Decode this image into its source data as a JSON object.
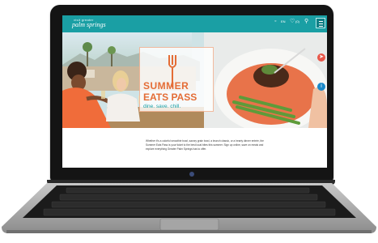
{
  "site": {
    "logo_small": "visit greater",
    "logo_main": "palm springs",
    "brand_color": "#1a9fa4",
    "accent_color": "#e46d36"
  },
  "nav": {
    "items": [
      {
        "icon": "globe-icon",
        "label": "EN"
      },
      {
        "icon": "heart-icon",
        "label": "(0)"
      },
      {
        "icon": "search-icon",
        "label": ""
      },
      {
        "icon": "menu-icon",
        "label": ""
      }
    ]
  },
  "hero": {
    "title_line1": "SUMMER",
    "title_line2": "EATS PASS",
    "tagline": "dine. save. chill.",
    "side_buttons": [
      {
        "icon": "share-icon",
        "color": "#e8574a"
      },
      {
        "icon": "info-icon",
        "color": "#1a88c9"
      }
    ]
  },
  "body_text": "Whether it’s a colorful smoothie bowl, savory grain bowl, a brunch classic, or a hearty dinner entrée, the Summer Eats Pass is your ticket to the best local bites this summer. Sign up online, save on meals and explore everything Greater Palm Springs has to offer."
}
